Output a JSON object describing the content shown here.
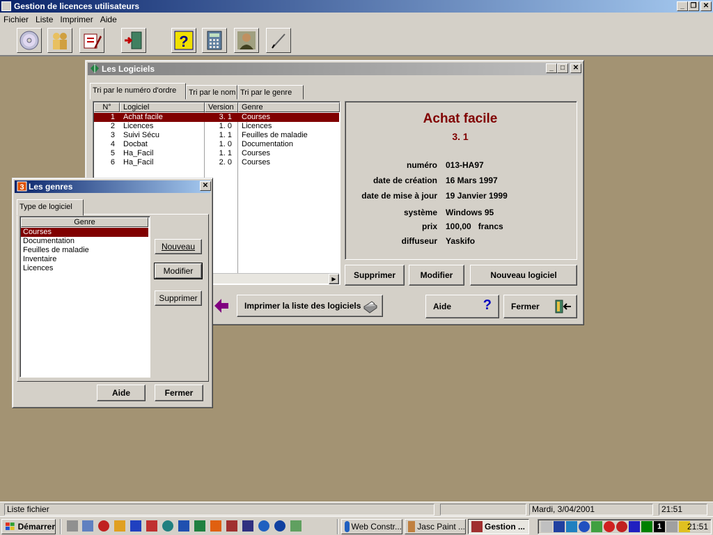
{
  "app": {
    "title": "Gestion de licences utilisateurs",
    "menu": [
      "Fichier",
      "Liste",
      "Imprimer",
      "Aide"
    ],
    "toolbar_icons": [
      "cd-icon",
      "users-icon",
      "edit-form-icon",
      "exit-door-icon",
      "help-icon",
      "calculator-icon",
      "person-icon",
      "pen-icon"
    ]
  },
  "logiciels": {
    "title": "Les Logiciels",
    "tabs": [
      "Tri par le numéro d'ordre",
      "Tri par le nom",
      "Tri par le genre"
    ],
    "columns": [
      "N°",
      "Logiciel",
      "Version",
      "Genre"
    ],
    "rows": [
      {
        "n": "1",
        "name": "Achat facile",
        "version": "3. 1",
        "genre": "Courses"
      },
      {
        "n": "2",
        "name": "Licences",
        "version": "1. 0",
        "genre": "Licences"
      },
      {
        "n": "3",
        "name": "Suivi Sécu",
        "version": "1. 1",
        "genre": "Feuilles de maladie"
      },
      {
        "n": "4",
        "name": "Docbat",
        "version": "1. 0",
        "genre": "Documentation"
      },
      {
        "n": "5",
        "name": "Ha_Facil",
        "version": "1. 1",
        "genre": "Courses"
      },
      {
        "n": "6",
        "name": "Ha_Facil",
        "version": "2. 0",
        "genre": "Courses"
      }
    ],
    "detail": {
      "name": "Achat facile",
      "version": "3. 1",
      "fields": [
        {
          "label": "numéro",
          "value": "013-HA97"
        },
        {
          "label": "date de création",
          "value": "16 Mars 1997"
        },
        {
          "label": "date de mise à jour",
          "value": "19 Janvier 1999"
        },
        {
          "label": "système",
          "value": "Windows 95"
        },
        {
          "label": "prix",
          "value": "100,00   francs"
        },
        {
          "label": "diffuseur",
          "value": "Yaskifo"
        }
      ]
    },
    "buttons": {
      "supprimer": "Supprimer",
      "modifier": "Modifier",
      "nouveau": "Nouveau logiciel",
      "imprimer": "Imprimer la liste des logiciels",
      "aide": "Aide",
      "fermer": "Fermer"
    }
  },
  "genres": {
    "title": "Les genres",
    "tab": "Type de logiciel",
    "column": "Genre",
    "items": [
      "Courses",
      "Documentation",
      "Feuilles de maladie",
      "Inventaire",
      "Licences"
    ],
    "buttons": {
      "nouveau": "Nouveau",
      "modifier": "Modifier",
      "supprimer": "Supprimer",
      "aide": "Aide",
      "fermer": "Fermer"
    }
  },
  "status": {
    "text": "Liste fichier",
    "date": "Mardi, 3/04/2001",
    "time": "21:51"
  },
  "taskbar": {
    "start": "Démarrer",
    "tasks": [
      "Web Constr...",
      "Jasc Paint ...",
      "Gestion ..."
    ],
    "clock": "21:51"
  },
  "colors": {
    "accent": "#800000",
    "title_active": "#0a246a",
    "title_inactive": "#808080",
    "desktop": "#a39373"
  }
}
